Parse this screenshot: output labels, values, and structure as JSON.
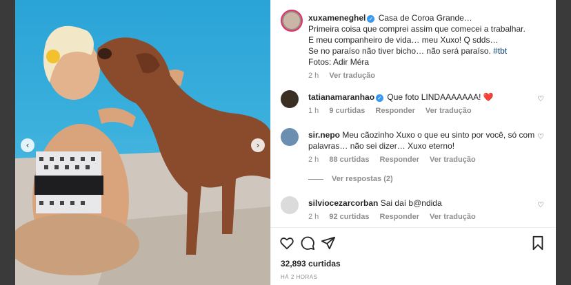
{
  "caption": {
    "username": "xuxameneghel",
    "lines": [
      "Casa de Coroa Grande…",
      "Primeira coisa que comprei assim que comecei a trabalhar.",
      "E meu companheiro de vida… meu Xuxo! Q sdds…",
      "Se no paraíso não tiver bicho… não será paraíso.",
      "Fotos: Adir Méra"
    ],
    "hashtag": "#tbt",
    "time": "2 h",
    "translate": "Ver tradução"
  },
  "comments": [
    {
      "username": "tatianamaranhao",
      "verified": true,
      "text": "Que foto LINDAAAAAAA! ❤️",
      "time": "1 h",
      "likes": "9 curtidas",
      "reply": "Responder",
      "translate": "Ver tradução"
    },
    {
      "username": "sir.nepo",
      "verified": false,
      "text": "Meu cãozinho Xuxo o que eu sinto por você, só com palavras… não sei dizer… Xuxo eterno!",
      "time": "2 h",
      "likes": "88 curtidas",
      "reply": "Responder",
      "translate": "Ver tradução",
      "view_replies": "Ver respostas (2)"
    },
    {
      "username": "silviocezarcorban",
      "verified": false,
      "text": "Sai daí b@ndida",
      "time": "2 h",
      "likes": "92 curtidas",
      "reply": "Responder",
      "translate": "Ver tradução"
    }
  ],
  "footer": {
    "likes": "32,893 curtidas",
    "time_ago": "HÁ 2 HORAS"
  },
  "icons": {
    "prev": "chevron-left-icon",
    "next": "chevron-right-icon",
    "like": "heart-icon",
    "comment": "comment-icon",
    "share": "send-icon",
    "save": "bookmark-icon"
  },
  "colors": {
    "verified": "#3897f0",
    "hashtag": "#00376b",
    "heart_emoji": "#e0245e"
  }
}
